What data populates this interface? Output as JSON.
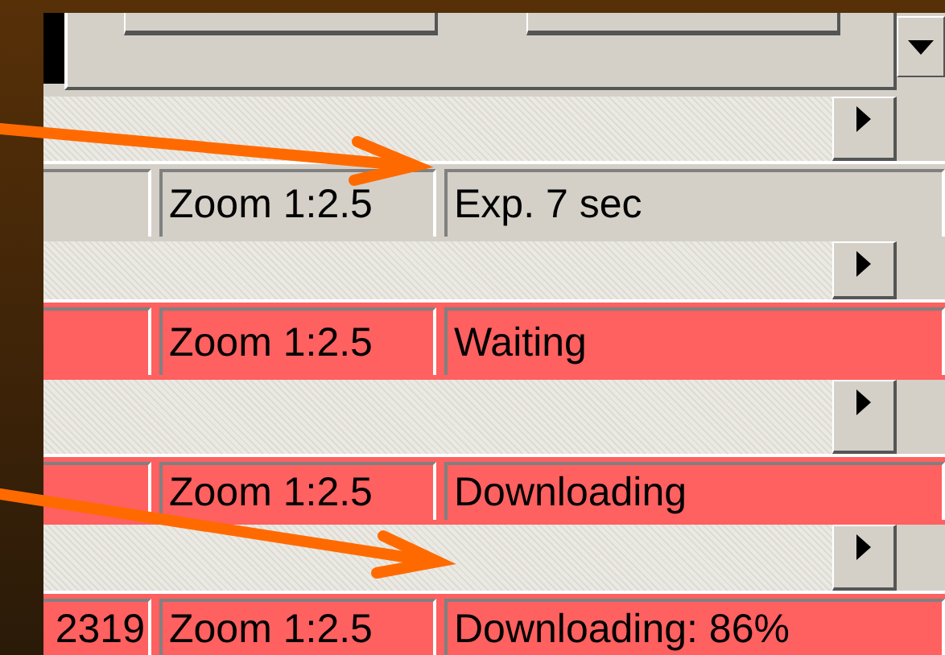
{
  "rows": [
    {
      "zoom": "Zoom 1:2.5",
      "status": "Exp. 7 sec",
      "highlighted": false
    },
    {
      "zoom": "Zoom 1:2.5",
      "status": "Waiting",
      "highlighted": true
    },
    {
      "zoom": "Zoom 1:2.5",
      "status": "Downloading",
      "highlighted": true
    },
    {
      "frame": "2319",
      "zoom": "Zoom 1:2.5",
      "status": "Downloading: 86%",
      "highlighted": true
    }
  ]
}
